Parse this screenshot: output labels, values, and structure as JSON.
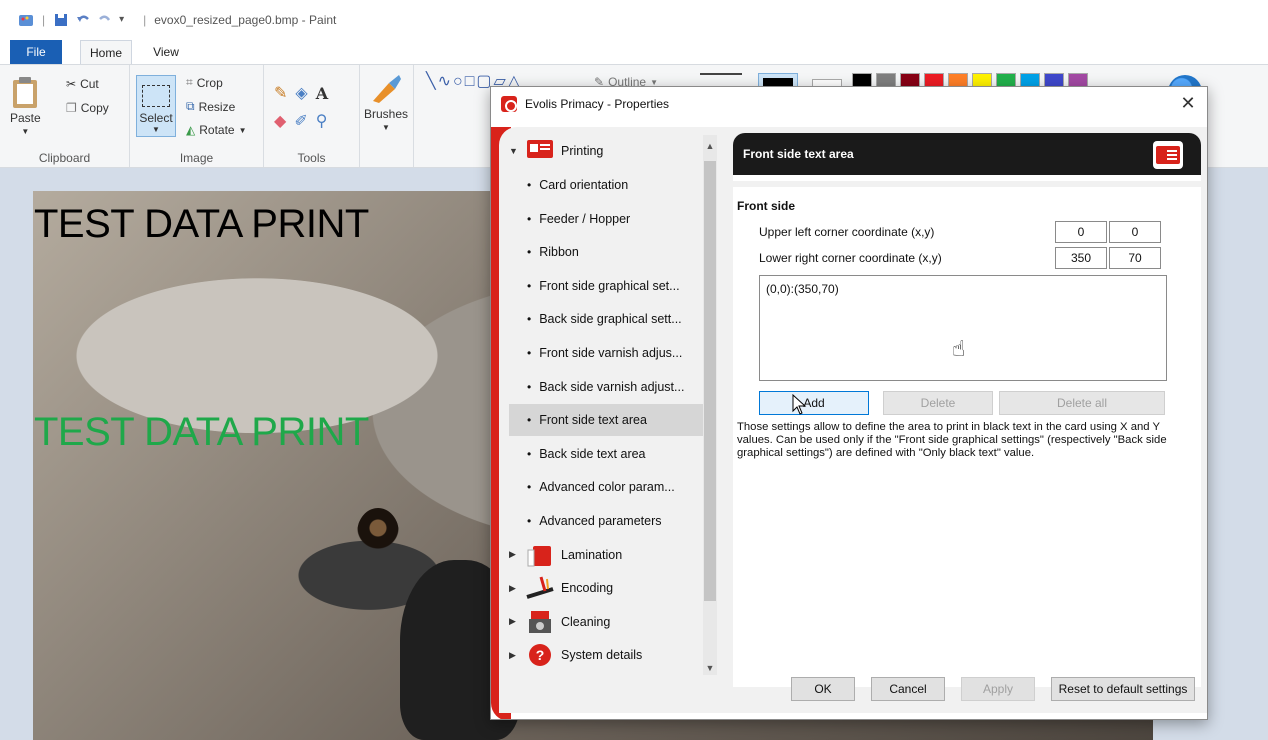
{
  "paint": {
    "window_title": "evox0_resized_page0.bmp - Paint",
    "tabs": [
      "File",
      "Home",
      "View"
    ],
    "clipboard": {
      "paste": "Paste",
      "cut": "Cut",
      "copy": "Copy",
      "label": "Clipboard"
    },
    "image": {
      "select": "Select",
      "crop": "Crop",
      "resize": "Resize",
      "rotate": "Rotate",
      "label": "Image"
    },
    "tools": {
      "label": "Tools",
      "brushes": "Brushes"
    },
    "shapes": {
      "outline": "Outline"
    },
    "canvas_text_black": "TEST DATA PRINT",
    "canvas_text_green": "TEST DATA PRINT",
    "palette": [
      "#000000",
      "#7f7f7f",
      "#880015",
      "#ed1c24",
      "#ff7f27",
      "#fff200",
      "#22b14c",
      "#00a2e8",
      "#3f48cc",
      "#a349a4"
    ]
  },
  "dialog": {
    "title": "Evolis Primacy - Properties",
    "tree": [
      {
        "type": "parent",
        "label": "Printing",
        "expanded": true,
        "icon": "printing-icon"
      },
      {
        "type": "child",
        "label": "Card orientation"
      },
      {
        "type": "child",
        "label": "Feeder / Hopper"
      },
      {
        "type": "child",
        "label": "Ribbon"
      },
      {
        "type": "child",
        "label": "Front side graphical set..."
      },
      {
        "type": "child",
        "label": "Back side graphical sett..."
      },
      {
        "type": "child",
        "label": "Front side varnish adjus..."
      },
      {
        "type": "child",
        "label": "Back side varnish adjust..."
      },
      {
        "type": "child",
        "label": "Front side text area",
        "selected": true
      },
      {
        "type": "child",
        "label": "Back side text area"
      },
      {
        "type": "child",
        "label": "Advanced color param..."
      },
      {
        "type": "child",
        "label": "Advanced parameters"
      },
      {
        "type": "parent",
        "label": "Lamination",
        "expanded": false,
        "icon": "lamination-icon"
      },
      {
        "type": "parent",
        "label": "Encoding",
        "expanded": false,
        "icon": "encoding-icon"
      },
      {
        "type": "parent",
        "label": "Cleaning",
        "expanded": false,
        "icon": "cleaning-icon"
      },
      {
        "type": "parent",
        "label": "System details",
        "expanded": false,
        "icon": "system-details-icon"
      }
    ],
    "panel": {
      "header": "Front side text area",
      "section": "Front side",
      "upper_left_label": "Upper left corner coordinate (x,y)",
      "upper_left_x": "0",
      "upper_left_y": "0",
      "lower_right_label": "Lower right corner coordinate (x,y)",
      "lower_right_x": "350",
      "lower_right_y": "70",
      "areas": [
        "(0,0):(350,70)"
      ],
      "add": "Add",
      "delete": "Delete",
      "delete_all": "Delete all",
      "description": "Those settings allow to define the area to print in black text in the card using X and Y values. Can be used only if the \"Front side graphical settings\" (respectively \"Back side graphical settings\") are defined with \"Only black text\" value."
    },
    "footer": {
      "ok": "OK",
      "cancel": "Cancel",
      "apply": "Apply",
      "reset": "Reset to default settings"
    }
  }
}
